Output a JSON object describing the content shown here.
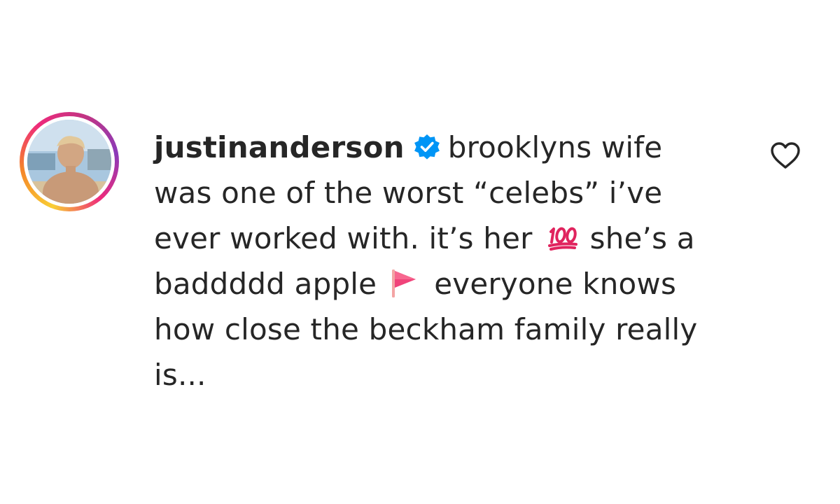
{
  "comment": {
    "username": "justinanderson",
    "verified_icon": "verified-badge-icon",
    "line1_tail": "brooklyns wife",
    "line2": "was one of the worst “celebs” i’ve",
    "line3_head": "ever worked with. it’s her",
    "emoji_1": "100-emoji",
    "line3_tail": "she’s a",
    "line4_head": "baddddd apple",
    "emoji_2": "red-flag-emoji",
    "line4_tail": "everyone knows",
    "line5": "how close the beckham family really",
    "line6": "is...",
    "like_icon": "heart-outline-icon"
  },
  "colors": {
    "text": "#262626",
    "verified_blue": "#0095f6",
    "emoji_red": "#e0245e"
  }
}
